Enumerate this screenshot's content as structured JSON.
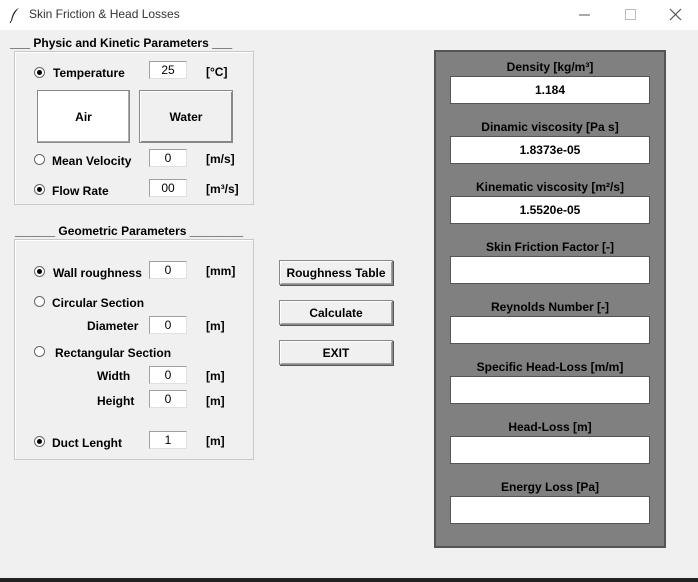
{
  "window": {
    "title": "Skin Friction & Head Losses",
    "minimize_glyph": "—",
    "maximize_glyph": "☐",
    "close_glyph": "✕"
  },
  "physic": {
    "title": "___ Physic and Kinetic Parameters ___",
    "temperature_label": "Temperature",
    "temperature_value": "25",
    "temperature_unit": "[°C]",
    "air_label": "Air",
    "water_label": "Water",
    "velocity_label": "Mean Velocity",
    "velocity_value": "0",
    "velocity_unit": "[m/s]",
    "flowrate_label": "Flow Rate",
    "flowrate_value": "00",
    "flowrate_unit": "[m³/s]"
  },
  "geometric": {
    "title": "______ Geometric Parameters ________",
    "roughness_label": "Wall roughness",
    "roughness_value": "0",
    "roughness_unit": "[mm]",
    "circular_label": "Circular Section",
    "diameter_label": "Diameter",
    "diameter_value": "0",
    "diameter_unit": "[m]",
    "rectangular_label": "Rectangular Section",
    "width_label": "Width",
    "width_value": "0",
    "width_unit": "[m]",
    "height_label": "Height",
    "height_value": "0",
    "height_unit": "[m]",
    "length_label": "Duct Lenght",
    "length_value": "1",
    "length_unit": "[m]"
  },
  "buttons": {
    "roughness_table": "Roughness Table",
    "calculate": "Calculate",
    "exit": "EXIT"
  },
  "results": [
    {
      "label": "Density [kg/m³]",
      "value": "1.184"
    },
    {
      "label": "Dinamic viscosity [Pa s]",
      "value": "1.8373e-05"
    },
    {
      "label": "Kinematic viscosity [m²/s]",
      "value": "1.5520e-05"
    },
    {
      "label": "Skin Friction Factor [-]",
      "value": ""
    },
    {
      "label": "Reynolds Number [-]",
      "value": ""
    },
    {
      "label": "Specific Head-Loss [m/m]",
      "value": ""
    },
    {
      "label": "Head-Loss [m]",
      "value": ""
    },
    {
      "label": "Energy Loss [Pa]",
      "value": ""
    }
  ],
  "colors": {
    "results_panel": "#808080",
    "window_bg": "#f0f0f0"
  },
  "icons": {
    "app": "feather-icon"
  }
}
